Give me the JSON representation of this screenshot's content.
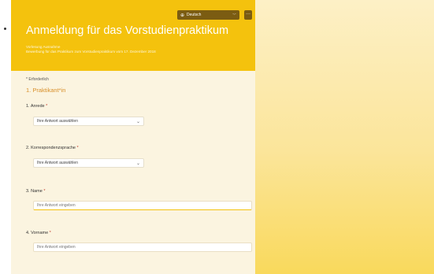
{
  "header": {
    "language": "Deutsch",
    "more": "···",
    "title": "Anmeldung für das Vorstudienpraktikum",
    "subtitle_line1": "Vorlesung Ausnahme",
    "subtitle_line2": "Bewerbung für das Praktikum zum Vorstudienpraktikum vom 17. Dezember 2018"
  },
  "form": {
    "required_hint": "* Erforderlich",
    "section_title": "1. Praktikant*in",
    "questions": [
      {
        "number": "1.",
        "label": "Anrede",
        "required": "*",
        "type": "select",
        "placeholder": "Ihre Antwort auswählen"
      },
      {
        "number": "2.",
        "label": "Korrespondenzsprache",
        "required": "*",
        "type": "select",
        "placeholder": "Ihre Antwort auswählen"
      },
      {
        "number": "3.",
        "label": "Name",
        "required": "*",
        "type": "text",
        "placeholder": "Ihre Antwort eingeben"
      },
      {
        "number": "4.",
        "label": "Vorname",
        "required": "*",
        "type": "text",
        "placeholder": "Ihre Antwort eingeben"
      }
    ]
  },
  "icons": {
    "language": "globe-icon",
    "dropdown": "chevron-down-icon",
    "more": "more-icon"
  },
  "colors": {
    "header": "#f4c20d",
    "section_title": "#d88f2a",
    "required": "#c0392b"
  }
}
